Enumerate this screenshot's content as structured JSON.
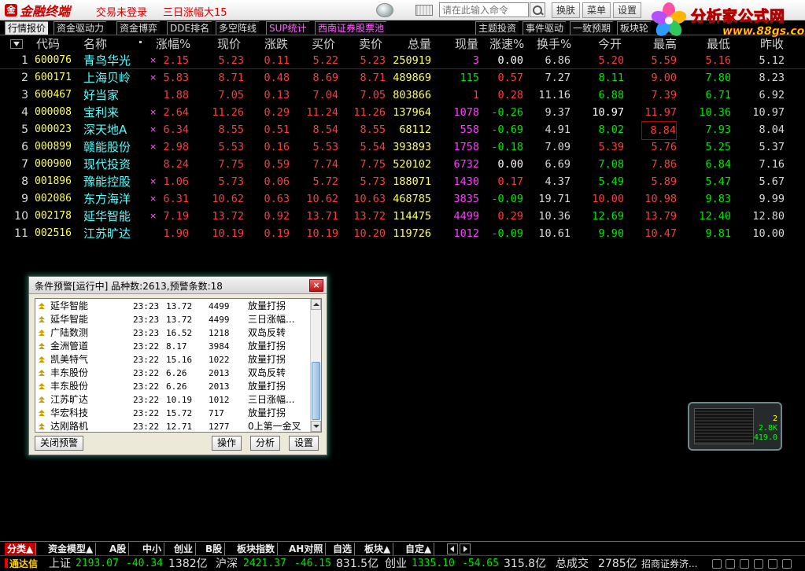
{
  "titlebar": {
    "app_name": "金融终端",
    "status1": "交易未登录",
    "status2": "三日涨幅大15",
    "search_placeholder": "请在此输入命令",
    "buttons": [
      "换肤",
      "菜单",
      "设置"
    ]
  },
  "brand": {
    "title": "分析家公式网",
    "url": "www.88gs.com"
  },
  "tabs_left": [
    "行情报价",
    "资金驱动力",
    "资金博弈",
    "DDE排名",
    "多空阵线",
    "SUP统计",
    "西南证券股票池"
  ],
  "tabs_right": [
    "主题投资",
    "事件驱动",
    "一致预期",
    "板块轮"
  ],
  "grid": {
    "headers": [
      "代码",
      "名称",
      "涨幅%",
      "现价",
      "涨跌",
      "买价",
      "卖价",
      "总量",
      "现量",
      "涨速%",
      "换手%",
      "今开",
      "最高",
      "最低",
      "昨收"
    ],
    "rows": [
      {
        "idx": "1",
        "code": "600076",
        "name": "青鸟华光",
        "mark": "×",
        "chg_pct": "2.15",
        "price": "5.23",
        "chg": "0.11",
        "bid": "5.22",
        "ask": "5.23",
        "vol": "250919",
        "cur_vol": "3",
        "speed": "0.00",
        "turnover": "6.86",
        "open": "5.20",
        "high": "5.59",
        "low": "5.16",
        "prev": "5.12"
      },
      {
        "idx": "2",
        "code": "600171",
        "name": "上海贝岭",
        "mark": "×",
        "chg_pct": "5.83",
        "price": "8.71",
        "chg": "0.48",
        "bid": "8.69",
        "ask": "8.71",
        "vol": "489869",
        "cur_vol": "115",
        "speed": "0.57",
        "turnover": "7.27",
        "open": "8.11",
        "high": "9.00",
        "low": "7.80",
        "prev": "8.23"
      },
      {
        "idx": "3",
        "code": "600467",
        "name": "好当家",
        "mark": "",
        "chg_pct": "1.88",
        "price": "7.05",
        "chg": "0.13",
        "bid": "7.04",
        "ask": "7.05",
        "vol": "803866",
        "cur_vol": "1",
        "speed": "0.28",
        "turnover": "11.16",
        "open": "6.88",
        "high": "7.39",
        "low": "6.71",
        "prev": "6.92"
      },
      {
        "idx": "4",
        "code": "000008",
        "name": "宝利来",
        "mark": "×",
        "chg_pct": "2.64",
        "price": "11.26",
        "chg": "0.29",
        "bid": "11.24",
        "ask": "11.26",
        "vol": "137964",
        "cur_vol": "1078",
        "speed": "-0.26",
        "turnover": "9.37",
        "open": "10.97",
        "high": "11.97",
        "low": "10.36",
        "prev": "10.97"
      },
      {
        "idx": "5",
        "code": "000023",
        "name": "深天地A",
        "mark": "×",
        "chg_pct": "6.34",
        "price": "8.55",
        "chg": "0.51",
        "bid": "8.54",
        "ask": "8.55",
        "vol": "68112",
        "cur_vol": "558",
        "speed": "-0.69",
        "turnover": "4.91",
        "open": "8.02",
        "high": "8.84",
        "low": "7.93",
        "prev": "8.04"
      },
      {
        "idx": "6",
        "code": "000899",
        "name": "赣能股份",
        "mark": "×",
        "chg_pct": "2.98",
        "price": "5.53",
        "chg": "0.16",
        "bid": "5.53",
        "ask": "5.54",
        "vol": "393893",
        "cur_vol": "1758",
        "speed": "-0.18",
        "turnover": "7.09",
        "open": "5.39",
        "high": "5.76",
        "low": "5.25",
        "prev": "5.37"
      },
      {
        "idx": "7",
        "code": "000900",
        "name": "现代投资",
        "mark": "",
        "chg_pct": "8.24",
        "price": "7.75",
        "chg": "0.59",
        "bid": "7.74",
        "ask": "7.75",
        "vol": "520102",
        "cur_vol": "6732",
        "speed": "0.00",
        "turnover": "6.69",
        "open": "7.08",
        "high": "7.86",
        "low": "6.84",
        "prev": "7.16"
      },
      {
        "idx": "8",
        "code": "001896",
        "name": "豫能控股",
        "mark": "×",
        "chg_pct": "1.06",
        "price": "5.73",
        "chg": "0.06",
        "bid": "5.72",
        "ask": "5.73",
        "vol": "188071",
        "cur_vol": "1430",
        "speed": "0.17",
        "turnover": "4.37",
        "open": "5.49",
        "high": "5.89",
        "low": "5.47",
        "prev": "5.67"
      },
      {
        "idx": "9",
        "code": "002086",
        "name": "东方海洋",
        "mark": "×",
        "chg_pct": "6.31",
        "price": "10.62",
        "chg": "0.63",
        "bid": "10.62",
        "ask": "10.63",
        "vol": "468785",
        "cur_vol": "3835",
        "speed": "-0.09",
        "turnover": "19.71",
        "open": "10.00",
        "high": "10.98",
        "low": "9.83",
        "prev": "9.99"
      },
      {
        "idx": "10",
        "code": "002178",
        "name": "延华智能",
        "mark": "×",
        "chg_pct": "7.19",
        "price": "13.72",
        "chg": "0.92",
        "bid": "13.71",
        "ask": "13.72",
        "vol": "114475",
        "cur_vol": "4499",
        "speed": "0.29",
        "turnover": "10.36",
        "open": "12.69",
        "high": "13.79",
        "low": "12.40",
        "prev": "12.80"
      },
      {
        "idx": "11",
        "code": "002516",
        "name": "江苏旷达",
        "mark": "",
        "chg_pct": "1.90",
        "price": "10.19",
        "chg": "0.19",
        "bid": "10.19",
        "ask": "10.20",
        "vol": "119726",
        "cur_vol": "1012",
        "speed": "-0.09",
        "turnover": "10.61",
        "open": "9.90",
        "high": "10.47",
        "low": "9.81",
        "prev": "10.00"
      }
    ]
  },
  "alert": {
    "title": "条件预警[运行中] 品种数:2613,预警条数:18",
    "close": "×",
    "items": [
      {
        "name": "延华智能",
        "time": "23:23",
        "price": "13.72",
        "vol": "4499",
        "signal": "放量打拐"
      },
      {
        "name": "延华智能",
        "time": "23:23",
        "price": "13.72",
        "vol": "4499",
        "signal": "三日涨幅..."
      },
      {
        "name": "广陆数测",
        "time": "23:23",
        "price": "16.52",
        "vol": "1218",
        "signal": "双岛反转"
      },
      {
        "name": "金洲管道",
        "time": "23:22",
        "price": "8.17",
        "vol": "3984",
        "signal": "放量打拐"
      },
      {
        "name": "凯美特气",
        "time": "23:22",
        "price": "15.16",
        "vol": "1022",
        "signal": "放量打拐"
      },
      {
        "name": "丰东股份",
        "time": "23:22",
        "price": "6.26",
        "vol": "2013",
        "signal": "双岛反转"
      },
      {
        "name": "丰东股份",
        "time": "23:22",
        "price": "6.26",
        "vol": "2013",
        "signal": "放量打拐"
      },
      {
        "name": "江苏旷达",
        "time": "23:22",
        "price": "10.19",
        "vol": "1012",
        "signal": "三日涨幅..."
      },
      {
        "name": "华宏科技",
        "time": "23:22",
        "price": "15.72",
        "vol": "717",
        "signal": "放量打拐"
      },
      {
        "name": "达刚路机",
        "time": "23:22",
        "price": "12.71",
        "vol": "1277",
        "signal": "0上第一金叉"
      }
    ],
    "buttons": {
      "close_alert": "关闭预警",
      "operate": "操作",
      "analyze": "分析",
      "settings": "设置"
    }
  },
  "mini_widget": {
    "v1": "2",
    "v2": "2.8K",
    "v3": "419.0"
  },
  "bottom_tabs": [
    "分类▲",
    "资金模型▲",
    "A股",
    "中小",
    "创业",
    "B股",
    "板块指数",
    "AH对照",
    "自选",
    "板块▲",
    "自定▲"
  ],
  "statusbar": {
    "brand": "通达信",
    "sh_label": "上证",
    "sh_val": "2193.07",
    "sh_chg": "-40.34",
    "sh_amt": "1382亿",
    "sz_label": "沪深",
    "sz_val": "2421.37",
    "sz_chg": "-46.15",
    "sz_amt": "831.5亿",
    "cy_label": "创业",
    "cy_val": "1335.10",
    "cy_chg": "-54.65",
    "cy_amt": "315.8亿",
    "total_label": "总成交",
    "total_val": "2785亿",
    "broker": "招商证券济..."
  }
}
